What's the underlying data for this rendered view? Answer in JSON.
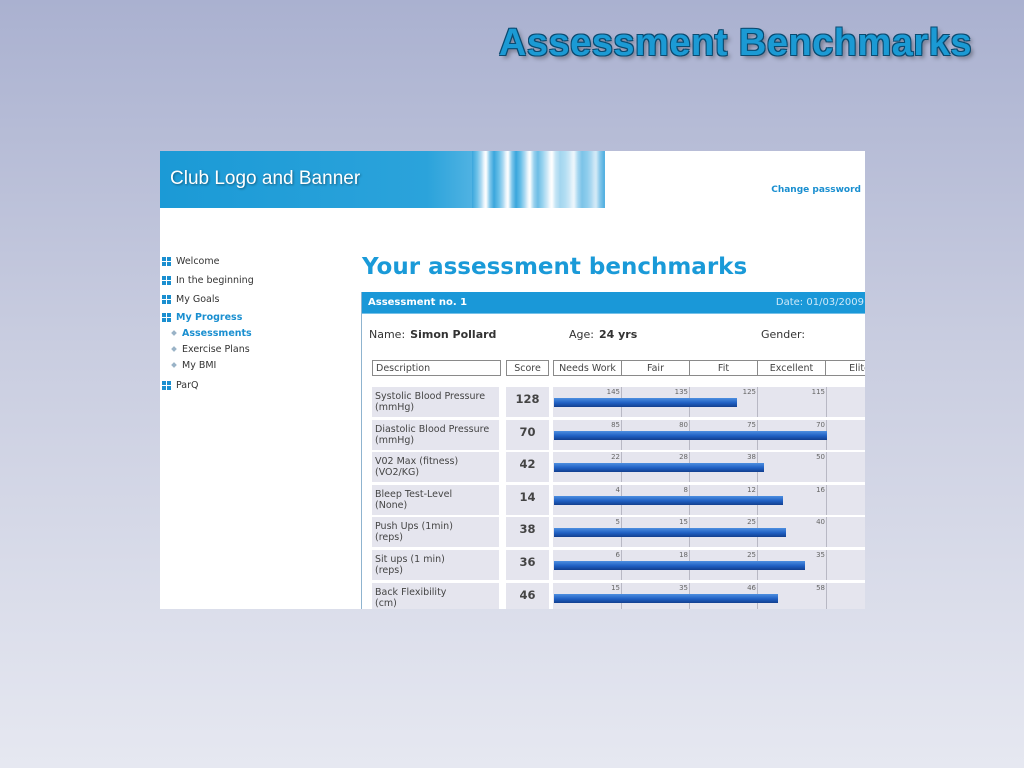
{
  "slide": {
    "title": "Assessment Benchmarks"
  },
  "header": {
    "banner_text": "Club Logo and Banner",
    "change_password": "Change password"
  },
  "nav": {
    "items": [
      {
        "label": "Welcome"
      },
      {
        "label": "In the beginning"
      },
      {
        "label": "My Goals"
      },
      {
        "label": "My Progress",
        "active": true
      }
    ],
    "sub_items": [
      {
        "label": "Assessments",
        "active": true
      },
      {
        "label": "Exercise Plans"
      },
      {
        "label": "My BMI"
      }
    ],
    "last_item": {
      "label": "ParQ"
    }
  },
  "main": {
    "title": "Your assessment benchmarks",
    "assessment_no": "Assessment no. 1",
    "date": "Date: 01/03/2009",
    "name_label": "Name:",
    "name_value": "Simon Pollard",
    "age_label": "Age:",
    "age_value": "24 yrs",
    "gender_label": "Gender:"
  },
  "table": {
    "headers": {
      "description": "Description",
      "score": "Score",
      "levels": [
        "Needs Work",
        "Fair",
        "Fit",
        "Excellent",
        "Elite"
      ]
    },
    "rows": [
      {
        "desc1": "Systolic Blood Pressure",
        "desc2": "(mmHg)",
        "score": "128",
        "ticks": [
          "145",
          "135",
          "125",
          "115"
        ],
        "fill": 0.67
      },
      {
        "desc1": "Diastolic Blood Pressure",
        "desc2": "(mmHg)",
        "score": "70",
        "ticks": [
          "85",
          "80",
          "75",
          "70"
        ],
        "fill": 1.0
      },
      {
        "desc1": "V02 Max (fitness)",
        "desc2": "(VO2/KG)",
        "score": "42",
        "ticks": [
          "22",
          "28",
          "38",
          "50"
        ],
        "fill": 0.77
      },
      {
        "desc1": "Bleep Test-Level",
        "desc2": "(None)",
        "score": "14",
        "ticks": [
          "4",
          "8",
          "12",
          "16"
        ],
        "fill": 0.84
      },
      {
        "desc1": "Push Ups (1min)",
        "desc2": "(reps)",
        "score": "38",
        "ticks": [
          "5",
          "15",
          "25",
          "40"
        ],
        "fill": 0.85
      },
      {
        "desc1": "Sit ups (1 min)",
        "desc2": "(reps)",
        "score": "36",
        "ticks": [
          "6",
          "18",
          "25",
          "35"
        ],
        "fill": 0.92
      },
      {
        "desc1": "Back Flexibility",
        "desc2": "(cm)",
        "score": "46",
        "ticks": [
          "15",
          "35",
          "46",
          "58"
        ],
        "fill": 0.82
      }
    ]
  },
  "colors": {
    "accent": "#1a98d8",
    "bar": "#1f5fc2",
    "row_bg": "#e5e5ee"
  }
}
